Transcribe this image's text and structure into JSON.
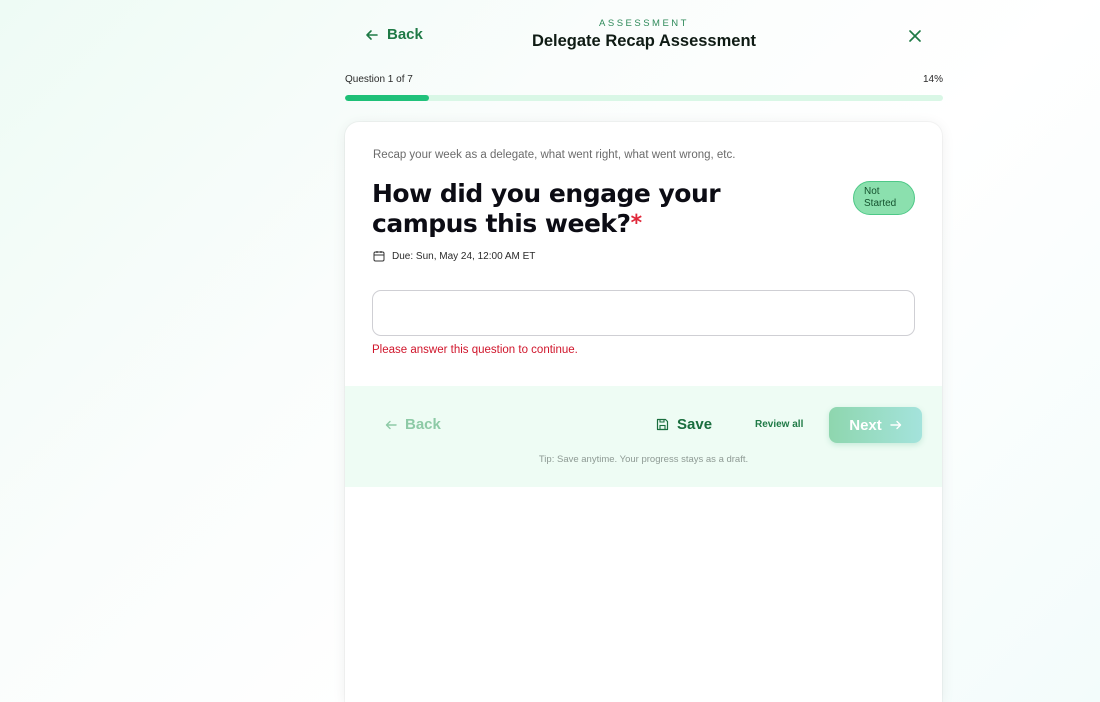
{
  "header": {
    "back_label": "Back",
    "eyebrow": "ASSESSMENT",
    "title": "Delegate Recap Assessment"
  },
  "progress": {
    "question_label": "Question 1 of 7",
    "percent_label": "14%",
    "percent": 14
  },
  "question": {
    "prompt": "Recap your week as a delegate, what went right, what went wrong, etc.",
    "text": "How did you engage your campus this week?",
    "required_mark": "*",
    "status": "Not Started",
    "due": "Due: Sun, May 24, 12:00 AM ET",
    "answer_value": "",
    "error": "Please answer this question to continue."
  },
  "footer": {
    "back_label": "Back",
    "save_label": "Save",
    "review_label": "Review all",
    "next_label": "Next",
    "tip": "Tip: Save anytime. Your progress stays as a draft."
  },
  "icons": {
    "back": "arrow-left-icon",
    "close": "close-icon",
    "calendar": "calendar-icon",
    "save": "save-icon",
    "next": "arrow-right-icon"
  },
  "colors": {
    "brand_green": "#1f7a46",
    "progress_fill": "#1dbf76",
    "error_red": "#d0152b",
    "status_badge": "#8be0ae"
  }
}
